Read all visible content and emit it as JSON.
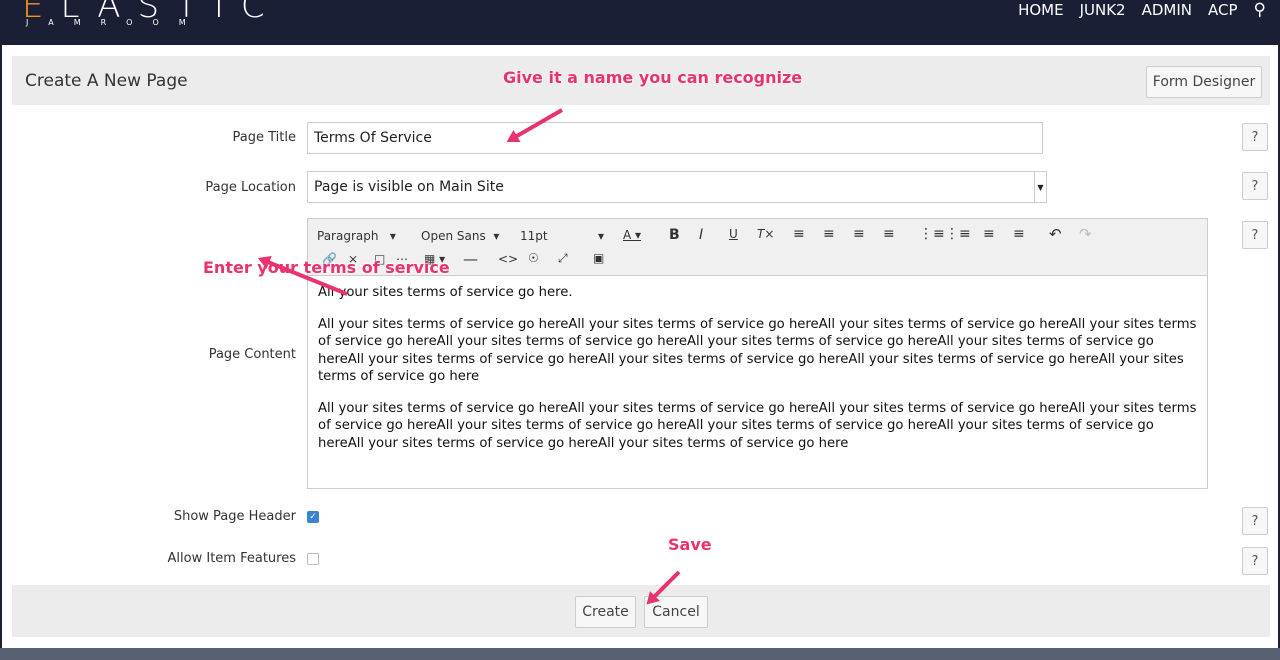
{
  "header": {
    "logo": "ELASTIC",
    "logo_sub": "JAMROOM",
    "nav": [
      "HOME",
      "JUNK2",
      "ADMIN",
      "ACP"
    ]
  },
  "panel": {
    "title": "Create A New Page",
    "form_designer": "Form Designer"
  },
  "annotations": {
    "name": "Give it a name you can recognize",
    "terms": "Enter your terms of service",
    "save": "Save"
  },
  "fields": {
    "page_title_label": "Page Title",
    "page_title_value": "Terms Of Service",
    "page_location_label": "Page Location",
    "page_location_value": "Page is visible on Main Site",
    "page_content_label": "Page Content",
    "show_header_label": "Show Page Header",
    "show_header_checked": true,
    "allow_features_label": "Allow Item Features",
    "allow_features_checked": false,
    "help": "?"
  },
  "toolbar": {
    "format": "Paragraph",
    "font": "Open Sans",
    "size": "11pt"
  },
  "content": {
    "p1": "All your sites terms of service go here.",
    "p2": "All your sites terms of service go hereAll your sites terms of service go hereAll your sites terms of service go hereAll your sites terms of service go hereAll your sites terms of service go hereAll your sites terms of service go hereAll your sites terms of service go hereAll your sites terms of service go hereAll your sites terms of service go hereAll your sites terms of service go hereAll your sites terms of service go here",
    "p3": "All your sites terms of service go hereAll your sites terms of service go hereAll your sites terms of service go hereAll your sites terms of service go hereAll your sites terms of service go hereAll your sites terms of service go hereAll your sites terms of service go hereAll your sites terms of service go hereAll your sites terms of service go here"
  },
  "buttons": {
    "create": "Create",
    "cancel": "Cancel"
  }
}
